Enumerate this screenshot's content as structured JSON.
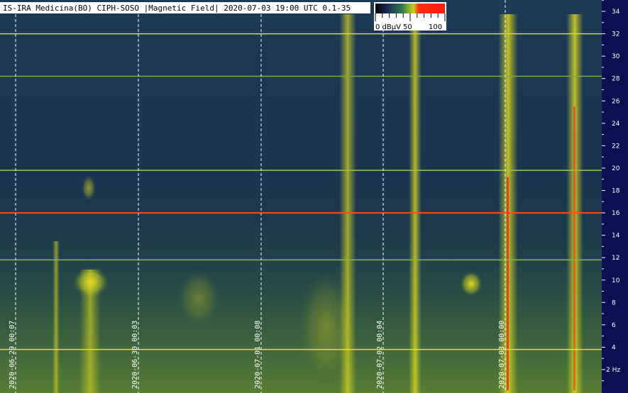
{
  "title": "IS-IRA Medicina(BO) CIPH-SOSO |Magnetic Field| 2020-07-03 19:00 UTC 0.1-35",
  "chart_data": {
    "type": "heatmap",
    "title": "IS-IRA Medicina(BO) CIPH-SOSO |Magnetic Field| 2020-07-03 19:00 UTC 0.1-35",
    "y_unit": "Hz",
    "y_ticks": [
      2,
      4,
      6,
      8,
      10,
      12,
      14,
      16,
      18,
      20,
      22,
      24,
      26,
      28,
      30,
      32,
      34
    ],
    "y_tick_labels": [
      "2 Hz",
      "4",
      "6",
      "8",
      "10",
      "12",
      "14",
      "16",
      "18",
      "20",
      "22",
      "24",
      "26",
      "28",
      "30",
      "32",
      "34"
    ],
    "ylim": [
      0.1,
      35
    ],
    "time_markers": [
      {
        "label": "2020-06-29 00:07",
        "x": "2020-06-29 00:07"
      },
      {
        "label": "2020-06-30 00:03",
        "x": "2020-06-30 00:03"
      },
      {
        "label": "2020-07-01 00:08",
        "x": "2020-07-01 00:08"
      },
      {
        "label": "2020-07-02 00:04",
        "x": "2020-07-02 00:04"
      },
      {
        "label": "2020-07-03 00:00",
        "x": "2020-07-03 00:00"
      }
    ],
    "colorbar": {
      "unit": "dBµV",
      "labels": [
        "0 dBµV",
        "50",
        "100"
      ],
      "range": [
        0,
        100
      ],
      "colors": [
        "#000000",
        "#1a2d5a",
        "#2a7a4a",
        "#c8d020",
        "#ff2010"
      ]
    },
    "horizontal_lines_hz": [
      {
        "freq": 32,
        "color": "#d8d838"
      },
      {
        "freq": 28.2,
        "color": "#7aa83a"
      },
      {
        "freq": 19.8,
        "color": "#9cc838"
      },
      {
        "freq": 16,
        "color": "#ff4a10"
      },
      {
        "freq": 11.8,
        "color": "#8ab838"
      },
      {
        "freq": 3.8,
        "color": "#e0e030"
      }
    ]
  }
}
